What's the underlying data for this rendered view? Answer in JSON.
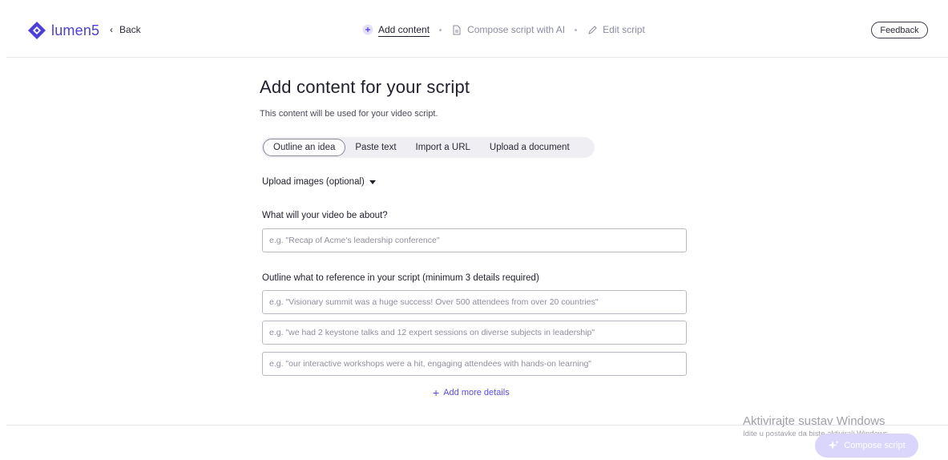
{
  "header": {
    "logo_text": "lumen5",
    "back_label": "Back",
    "steps": [
      {
        "label": "Add content",
        "icon": "plus-circle-icon",
        "active": true
      },
      {
        "label": "Compose script with AI",
        "icon": "document-icon",
        "active": false
      },
      {
        "label": "Edit script",
        "icon": "pencil-icon",
        "active": false
      }
    ],
    "feedback_label": "Feedback"
  },
  "main": {
    "title": "Add content for your script",
    "subtitle": "This content will be used for your video script.",
    "tabs": [
      {
        "label": "Outline an idea",
        "selected": true
      },
      {
        "label": "Paste text",
        "selected": false
      },
      {
        "label": "Import a URL",
        "selected": false
      },
      {
        "label": "Upload a document",
        "selected": false
      }
    ],
    "upload_images_label": "Upload images (optional)",
    "about_label": "What will your video be about?",
    "about_placeholder": "e.g. \"Recap of Acme's leadership conference\"",
    "outline_label": "Outline what to reference in your script (minimum 3 details required)",
    "outline_placeholders": [
      "e.g. \"Visionary summit was a huge success! Over 500 attendees from over 20 countries\"",
      "e.g. \"we had 2 keystone talks and 12 expert sessions on diverse subjects in leadership\"",
      "e.g. \"our interactive workshops were a hit, engaging attendees with hands-on learning\""
    ],
    "add_more_label": "Add more details"
  },
  "footer": {
    "compose_label": "Compose script"
  },
  "watermark": {
    "title": "Aktivirajte sustav Windows",
    "subtitle": "Idite u postavke da biste aktivirali Windows."
  },
  "colors": {
    "brand": "#4b3fd8",
    "accent": "#5a4de0",
    "compose_disabled": "#d9d5fb"
  }
}
